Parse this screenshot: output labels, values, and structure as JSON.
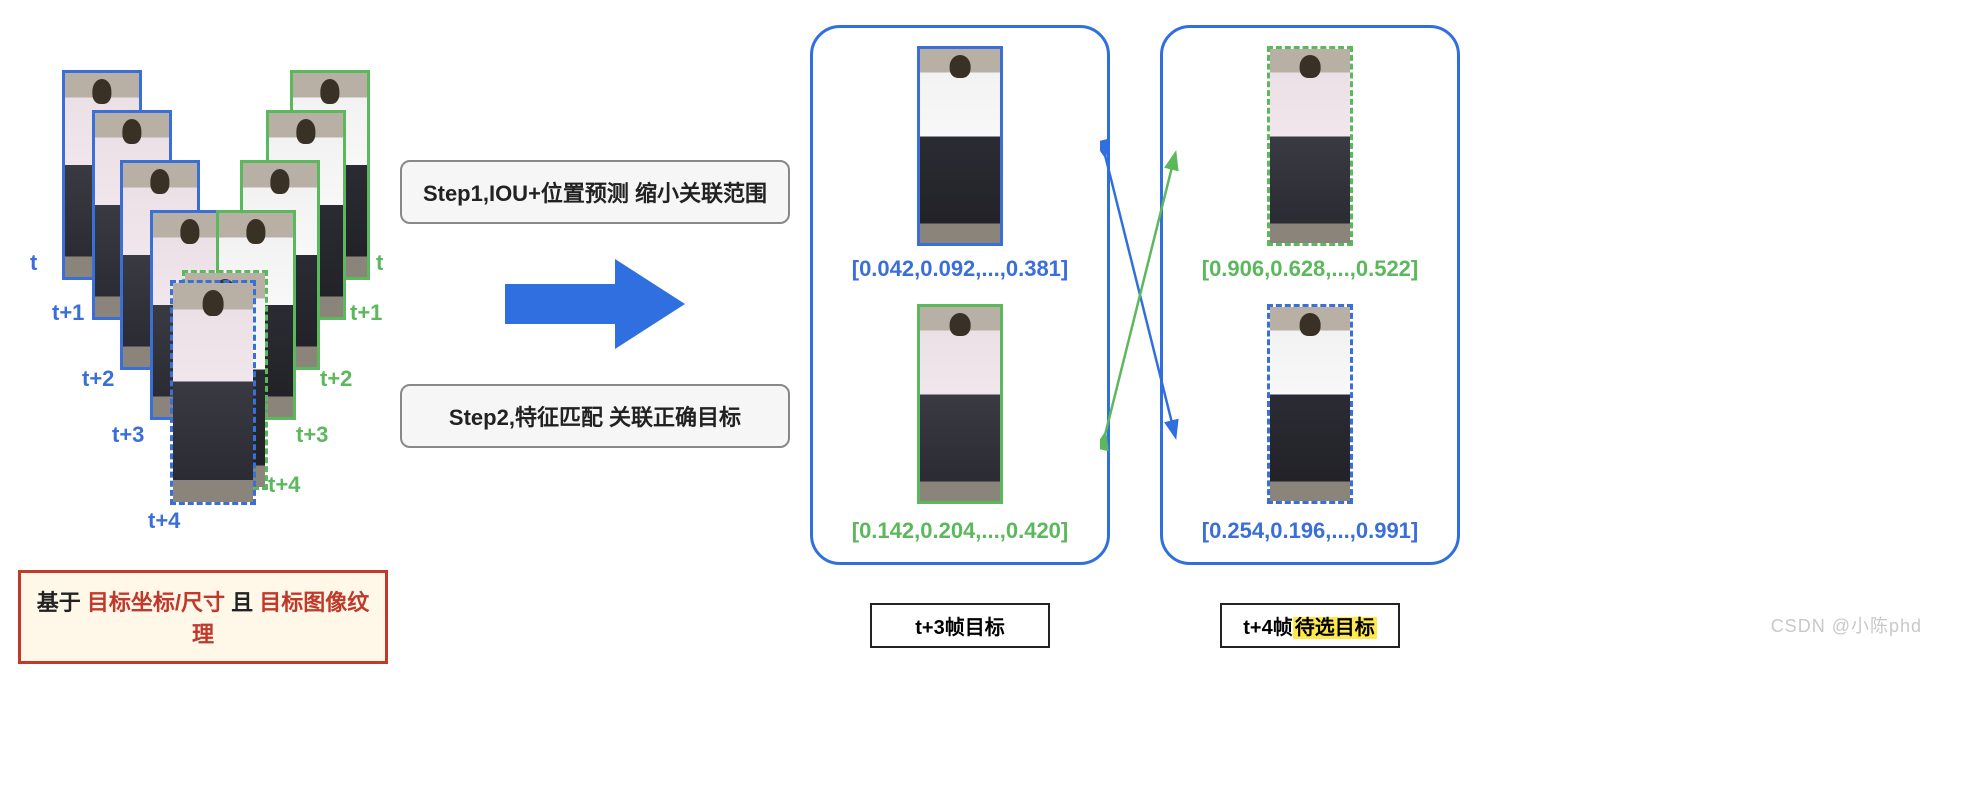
{
  "cascade": {
    "blue_labels": [
      "t",
      "t+1",
      "t+2",
      "t+3",
      "t+4"
    ],
    "green_labels": [
      "t",
      "t+1",
      "t+2",
      "t+3",
      "t+4"
    ]
  },
  "steps": {
    "step1": "Step1,IOU+位置预测 缩小关联范围",
    "step2": "Step2,特征匹配 关联正确目标"
  },
  "panel_left": {
    "vec_top": "[0.042,0.092,...,0.381]",
    "vec_bottom": "[0.142,0.204,...,0.420]",
    "caption": "t+3帧目标"
  },
  "panel_right": {
    "vec_top": "[0.906,0.628,...,0.522]",
    "vec_bottom": "[0.254,0.196,...,0.991]",
    "caption_prefix": "t+4帧",
    "caption_highlight": "待选目标"
  },
  "bottom": {
    "t1": "基于 ",
    "t2": "目标坐标/尺寸",
    "t3": " 且 ",
    "t4": "目标图像纹理"
  },
  "watermark": "CSDN @小陈phd",
  "chart_data": {
    "type": "diagram",
    "title": "基于 目标坐标/尺寸 且 目标图像纹理",
    "left_track_sequence": {
      "blue_track_frames": [
        "t",
        "t+1",
        "t+2",
        "t+3",
        "t+4"
      ],
      "green_track_frames": [
        "t",
        "t+1",
        "t+2",
        "t+3",
        "t+4"
      ],
      "note": "两条行人轨迹在 t 到 t+4 帧逐渐靠近并于 t+4 重叠"
    },
    "pipeline_steps": [
      "Step1,IOU+位置预测 缩小关联范围",
      "Step2,特征匹配 关联正确目标"
    ],
    "matching": {
      "left_panel": "t+3帧目标",
      "right_panel": "t+4帧待选目标",
      "left_features": {
        "blue_target_vector": "[0.042,0.092,...,0.381]",
        "green_target_vector": "[0.142,0.204,...,0.420]"
      },
      "right_features": {
        "green_candidate_vector": "[0.906,0.628,...,0.522]",
        "blue_candidate_vector": "[0.254,0.196,...,0.991]"
      },
      "associations": [
        {
          "from": "left.blue_target",
          "to": "right.blue_candidate",
          "color": "blue"
        },
        {
          "from": "left.green_target",
          "to": "right.green_candidate",
          "color": "green"
        }
      ]
    }
  }
}
